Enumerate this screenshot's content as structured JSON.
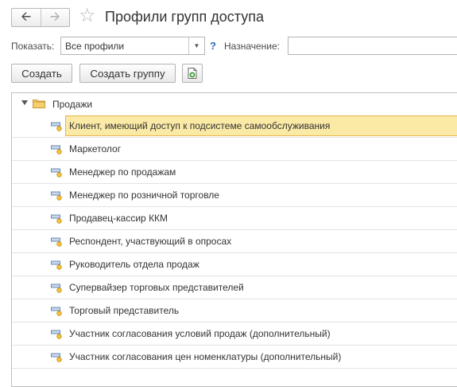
{
  "header": {
    "back_icon": "arrow-left-icon",
    "forward_icon": "arrow-right-icon",
    "favorite_icon": "star-icon",
    "title": "Профили групп доступа"
  },
  "filters": {
    "show_label": "Показать:",
    "show_value": "Все профили",
    "help_label": "?",
    "purpose_label": "Назначение:",
    "purpose_value": ""
  },
  "toolbar": {
    "create_label": "Создать",
    "create_group_label": "Создать группу",
    "copy_icon": "copy-document-icon"
  },
  "tree": {
    "group": {
      "label": "Продажи",
      "icon": "folder-icon",
      "expanded": true
    },
    "items": [
      {
        "label": "Клиент, имеющий доступ к подсистеме самообслуживания",
        "selected": true
      },
      {
        "label": "Маркетолог"
      },
      {
        "label": "Менеджер по продажам"
      },
      {
        "label": "Менеджер по розничной торговле"
      },
      {
        "label": "Продавец-кассир ККМ"
      },
      {
        "label": "Респондент, участвующий в опросах"
      },
      {
        "label": "Руководитель отдела продаж"
      },
      {
        "label": "Супервайзер торговых представителей"
      },
      {
        "label": "Торговый представитель"
      },
      {
        "label": "Участник согласования условий продаж (дополнительный)"
      },
      {
        "label": "Участник согласования цен номенклатуры (дополнительный)"
      }
    ]
  },
  "colors": {
    "selection_fill": "#fbe9a6",
    "selection_border": "#e8b64d",
    "folder": "#e9b949",
    "help": "#2a6ebb"
  }
}
